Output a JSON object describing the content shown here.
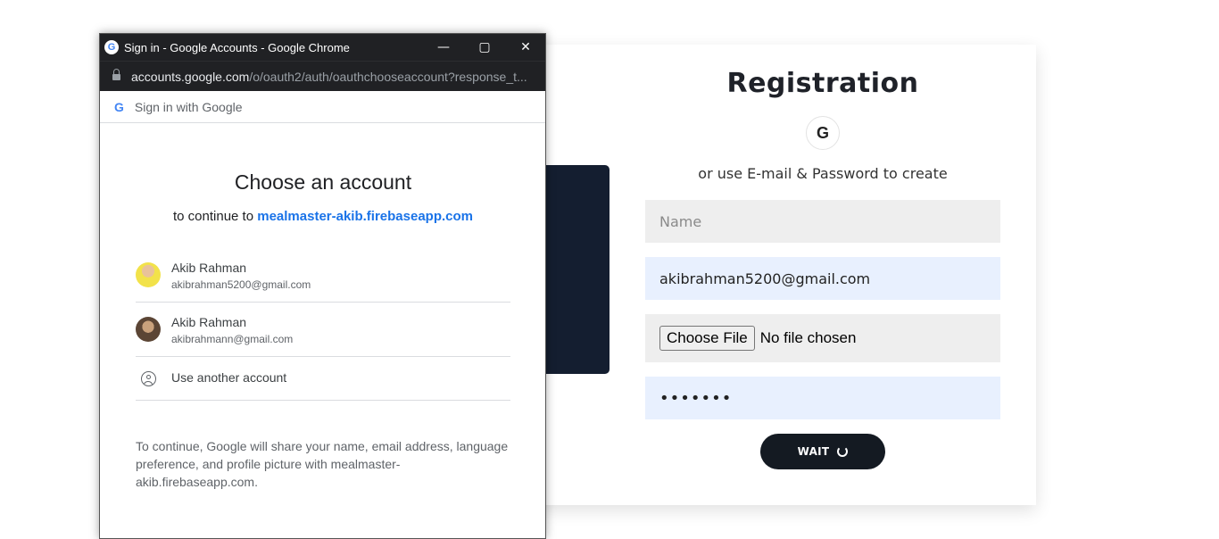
{
  "registration": {
    "title": "Registration",
    "google_icon": "google-icon",
    "google_glyph": "G",
    "or_text": "or use E-mail & Password to create",
    "name_placeholder": "Name",
    "email_value": "akibrahman5200@gmail.com",
    "file_button": "Choose File",
    "file_status": "No file chosen",
    "password_value": "•••••••",
    "submit_label": "WAIT",
    "colors": {
      "dark_panel": "#141e30",
      "button": "#141a22",
      "autofill_bg": "#e8f0fe"
    }
  },
  "popup": {
    "window_title": "Sign in - Google Accounts - Google Chrome",
    "titlebar_glyph": "G",
    "controls": {
      "minimize": "—",
      "maximize": "▢",
      "close": "✕"
    },
    "url_host": "accounts.google.com",
    "url_path": "/o/oauth2/auth/oauthchooseaccount?response_t...",
    "header_glyph": "G",
    "header_label": "Sign in with Google",
    "heading": "Choose an account",
    "continue_prefix": "to continue to",
    "continue_app": "mealmaster-akib.firebaseapp.com",
    "accounts": [
      {
        "name": "Akib Rahman",
        "email": "akibrahman5200@gmail.com"
      },
      {
        "name": "Akib Rahman",
        "email": "akibrahmann@gmail.com"
      }
    ],
    "use_another": "Use another account",
    "disclaimer": "To continue, Google will share your name, email address, language preference, and profile picture with mealmaster-akib.firebaseapp.com."
  }
}
